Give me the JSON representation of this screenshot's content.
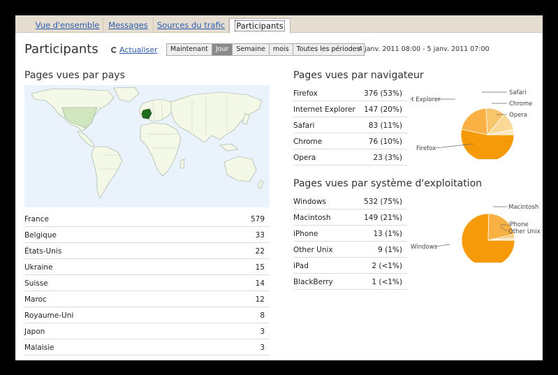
{
  "tabs": [
    {
      "label": "Vue d'ensemble",
      "active": false
    },
    {
      "label": "Messages",
      "active": false
    },
    {
      "label": "Sources du trafic",
      "active": false
    },
    {
      "label": "Participants",
      "active": true
    }
  ],
  "header": {
    "title": "Participants",
    "refresh_label": "Actualiser",
    "periods": [
      "Maintenant",
      "Jour",
      "Semaine",
      "mois",
      "Toutes les périodes"
    ],
    "selected_period": "Jour",
    "date_range": "4 janv. 2011 08:00 - 5 janv. 2011 07:00"
  },
  "countries": {
    "title": "Pages vues par pays",
    "highlight_color": "#1e6b1e",
    "rows": [
      {
        "name": "France",
        "value": "579"
      },
      {
        "name": "Belgique",
        "value": "33"
      },
      {
        "name": "États-Unis",
        "value": "22"
      },
      {
        "name": "Ukraine",
        "value": "15"
      },
      {
        "name": "Suisse",
        "value": "14"
      },
      {
        "name": "Maroc",
        "value": "12"
      },
      {
        "name": "Royaume-Uni",
        "value": "8"
      },
      {
        "name": "Japon",
        "value": "3"
      },
      {
        "name": "Malaisie",
        "value": "3"
      }
    ]
  },
  "browsers": {
    "title": "Pages vues par navigateur",
    "rows": [
      {
        "name": "Firefox",
        "value": "376 (53%)"
      },
      {
        "name": "Internet Explorer",
        "value": "147 (20%)"
      },
      {
        "name": "Safari",
        "value": "83 (11%)"
      },
      {
        "name": "Chrome",
        "value": "76 (10%)"
      },
      {
        "name": "Opera",
        "value": "23 (3%)"
      }
    ],
    "pie_labels": {
      "firefox": "Firefox",
      "ie": "et Explorer",
      "safari": "Safari",
      "chrome": "Chrome",
      "opera": "Opera"
    }
  },
  "os": {
    "title": "Pages vues par système d'exploitation",
    "rows": [
      {
        "name": "Windows",
        "value": "532 (75%)"
      },
      {
        "name": "Macintosh",
        "value": "149 (21%)"
      },
      {
        "name": "iPhone",
        "value": "13 (1%)"
      },
      {
        "name": "Other Unix",
        "value": "9 (1%)"
      },
      {
        "name": "iPad",
        "value": "2 (<1%)"
      },
      {
        "name": "BlackBerry",
        "value": "1 (<1%)"
      }
    ],
    "pie_labels": {
      "windows": "Windows",
      "macintosh": "Macintosh",
      "iphone": "iPhone",
      "other_unix": "Other Unix"
    }
  },
  "colors": {
    "pie_main": "#f79a0a",
    "pie_2": "#f8b142",
    "pie_3": "#f9c56b",
    "pie_4": "#fad996",
    "pie_5": "#fde8bf",
    "link": "#2a5db0",
    "map_land": "#f3f9e6",
    "map_sea": "#eaf3fb",
    "us_shade": "#cfe6bf"
  }
}
